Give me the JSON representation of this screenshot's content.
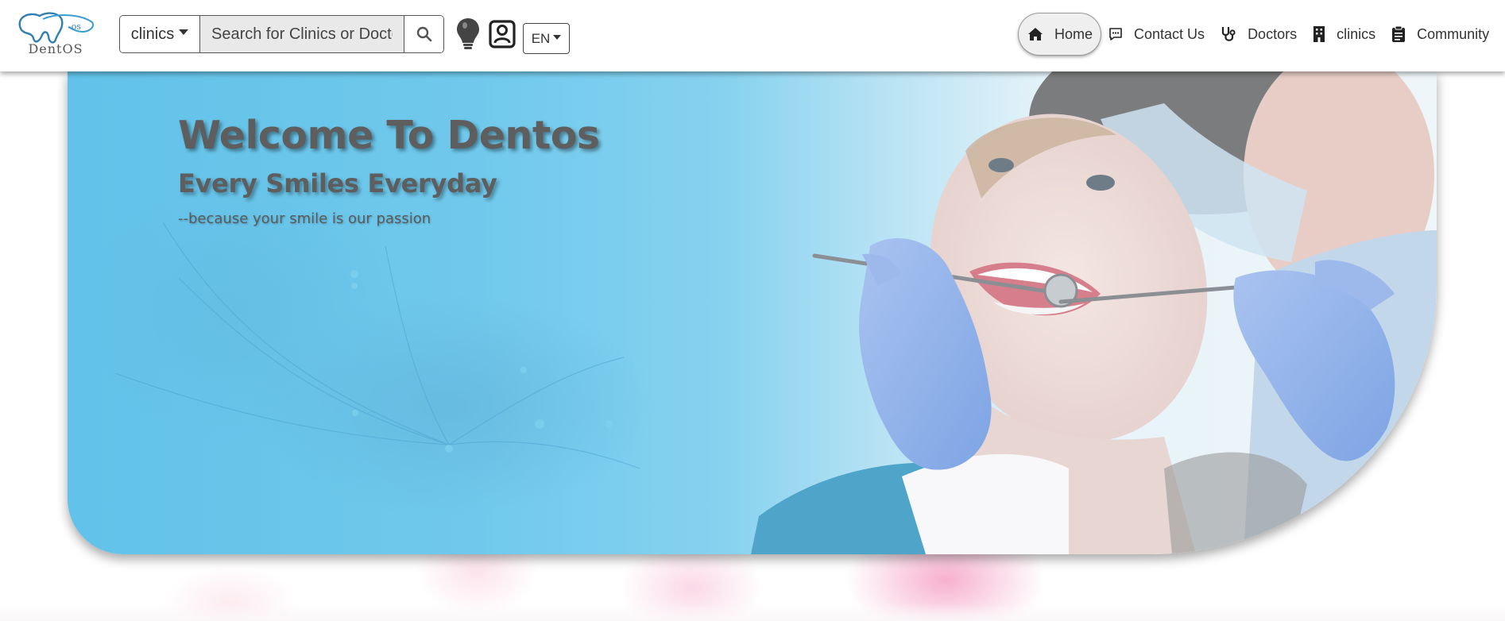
{
  "brand": {
    "logo_text": "DentOS",
    "logo_badge": "-os"
  },
  "search": {
    "type_selected": "clinics",
    "placeholder": "Search for Clinics or Doctors"
  },
  "language": {
    "selected": "EN"
  },
  "nav": {
    "items": [
      {
        "label": "Home",
        "icon": "home-icon",
        "active": true
      },
      {
        "label": "Contact Us",
        "icon": "chat-icon",
        "active": false
      },
      {
        "label": "Doctors",
        "icon": "stethoscope-icon",
        "active": false
      },
      {
        "label": "clinics",
        "icon": "building-icon",
        "active": false
      },
      {
        "label": "Community",
        "icon": "clipboard-icon",
        "active": false
      }
    ]
  },
  "hero": {
    "title": "Welcome To Dentos",
    "subtitle": "Every Smiles Everyday",
    "tagline": "--because your smile is our passion"
  },
  "colors": {
    "hero_blue": "#62c2e9",
    "text_dark": "#5e5e5e",
    "glove_blue": "#8fb3ec",
    "accent_pink": "#f496be"
  }
}
